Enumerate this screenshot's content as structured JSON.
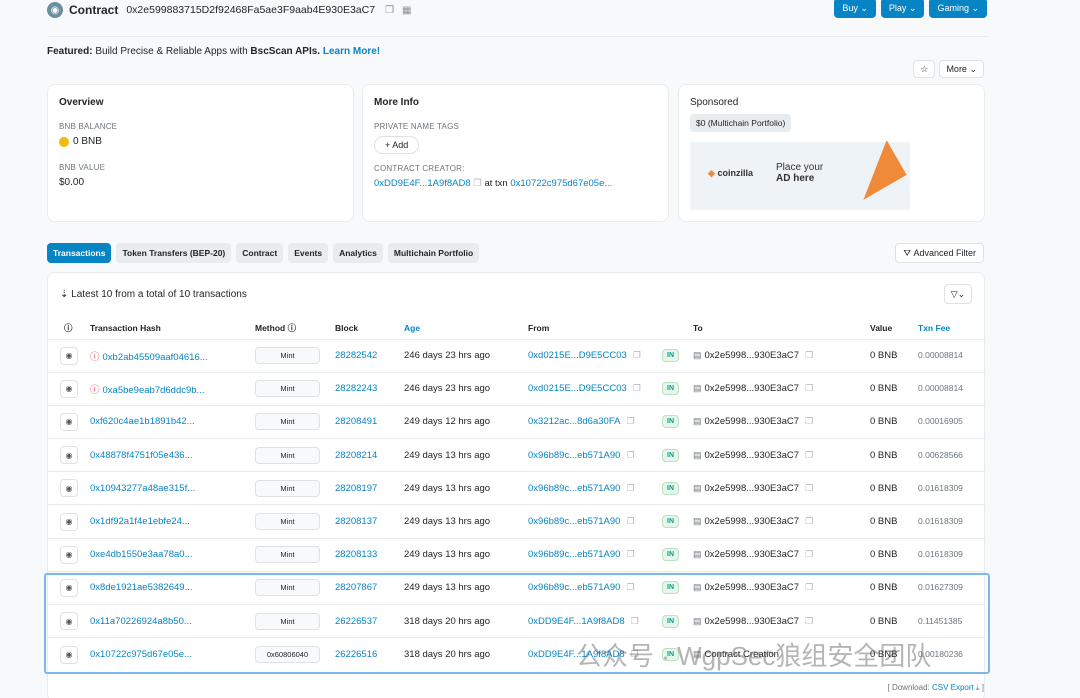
{
  "header": {
    "title": "Contract",
    "address": "0x2e599883715D2f92468Fa5ae3F9aab4E930E3aC7",
    "buttons": [
      "Buy",
      "Play",
      "Gaming"
    ]
  },
  "featured": {
    "prefix": "Featured:",
    "text": " Build Precise & Reliable Apps with ",
    "bold": "BscScan APIs.",
    "link": " Learn More!"
  },
  "more_label": "More",
  "overview": {
    "title": "Overview",
    "balance_label": "BNB BALANCE",
    "balance_value": "0 BNB",
    "value_label": "BNB VALUE",
    "value_value": "$0.00"
  },
  "more_info": {
    "title": "More Info",
    "tags_label": "PRIVATE NAME TAGS",
    "add_label": "+ Add",
    "creator_label": "CONTRACT CREATOR:",
    "creator_addr": "0xDD9E4F...1A9f8AD8",
    "at_txn": "at txn",
    "txn": "0x10722c975d67e05e..."
  },
  "sponsored": {
    "title": "Sponsored",
    "chip": "$0 (Multichain Portfolio)",
    "ad_logo": "coinzilla",
    "ad_text_1": "Place your",
    "ad_text_2": "AD here"
  },
  "tabs": [
    "Transactions",
    "Token Transfers (BEP-20)",
    "Contract",
    "Events",
    "Analytics",
    "Multichain Portfolio"
  ],
  "advanced_filter": "Advanced Filter",
  "summary": "Latest 10 from a total of 10 transactions",
  "columns": [
    "Transaction Hash",
    "Method",
    "Block",
    "Age",
    "From",
    "",
    "To",
    "Value",
    "Txn Fee"
  ],
  "rows": [
    {
      "hash": "0xb2ab45509aaf04616...",
      "err": true,
      "method": "Mint",
      "block": "28282542",
      "age": "246 days 23 hrs ago",
      "from": "0xd0215E...D9E5CC03",
      "to": "0x2e5998...930E3aC7",
      "value": "0 BNB",
      "fee": "0.00008814"
    },
    {
      "hash": "0xa5be9eab7d6ddc9b...",
      "err": true,
      "method": "Mint",
      "block": "28282243",
      "age": "246 days 23 hrs ago",
      "from": "0xd0215E...D9E5CC03",
      "to": "0x2e5998...930E3aC7",
      "value": "0 BNB",
      "fee": "0.00008814"
    },
    {
      "hash": "0xf620c4ae1b1891b42...",
      "err": false,
      "method": "Mint",
      "block": "28208491",
      "age": "249 days 12 hrs ago",
      "from": "0x3212ac...8d6a30FA",
      "to": "0x2e5998...930E3aC7",
      "value": "0 BNB",
      "fee": "0.00016905"
    },
    {
      "hash": "0x48878f4751f05e436...",
      "err": false,
      "method": "Mint",
      "block": "28208214",
      "age": "249 days 13 hrs ago",
      "from": "0x96b89c...eb571A90",
      "to": "0x2e5998...930E3aC7",
      "value": "0 BNB",
      "fee": "0.00628566"
    },
    {
      "hash": "0x10943277a48ae315f...",
      "err": false,
      "method": "Mint",
      "block": "28208197",
      "age": "249 days 13 hrs ago",
      "from": "0x96b89c...eb571A90",
      "to": "0x2e5998...930E3aC7",
      "value": "0 BNB",
      "fee": "0.01618309"
    },
    {
      "hash": "0x1df92a1f4e1ebfe24...",
      "err": false,
      "method": "Mint",
      "block": "28208137",
      "age": "249 days 13 hrs ago",
      "from": "0x96b89c...eb571A90",
      "to": "0x2e5998...930E3aC7",
      "value": "0 BNB",
      "fee": "0.01618309"
    },
    {
      "hash": "0xe4db1550e3aa78a0...",
      "err": false,
      "method": "Mint",
      "block": "28208133",
      "age": "249 days 13 hrs ago",
      "from": "0x96b89c...eb571A90",
      "to": "0x2e5998...930E3aC7",
      "value": "0 BNB",
      "fee": "0.01618309"
    },
    {
      "hash": "0x8de1921ae5382649...",
      "err": false,
      "method": "Mint",
      "block": "28207867",
      "age": "249 days 13 hrs ago",
      "from": "0x96b89c...eb571A90",
      "to": "0x2e5998...930E3aC7",
      "value": "0 BNB",
      "fee": "0.01627309"
    },
    {
      "hash": "0x11a70226924a8b50...",
      "err": false,
      "method": "Mint",
      "block": "26226537",
      "age": "318 days 20 hrs ago",
      "from": "0xDD9E4F...1A9f8AD8",
      "to": "0x2e5998...930E3aC7",
      "value": "0 BNB",
      "fee": "0.11451385"
    },
    {
      "hash": "0x10722c975d67e05e...",
      "err": false,
      "method": "0x60806040",
      "block": "26226516",
      "age": "318 days 20 hrs ago",
      "from": "0xDD9E4F...1A9f8AD8",
      "to": "Contract Creation",
      "value": "0 BNB",
      "fee": "0.00180236"
    }
  ],
  "watermark": "公众号 · WgpSec狼组安全团队",
  "footer": {
    "prefix": "[ Download: ",
    "link": "CSV Export",
    "suffix": " ]"
  }
}
